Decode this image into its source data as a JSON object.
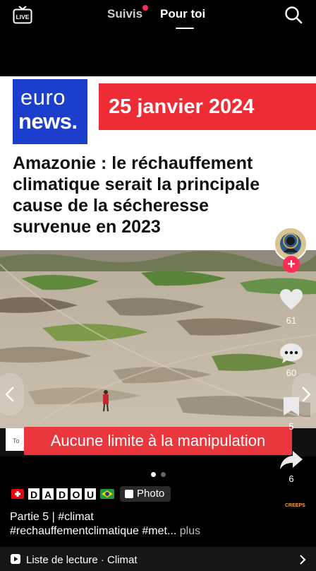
{
  "top_nav": {
    "live_label": "LIVE",
    "tab_following": "Suivis",
    "tab_for_you": "Pour toi"
  },
  "card": {
    "logo_line1": "euro",
    "logo_line2": "news.",
    "date": "25 janvier 2024",
    "headline_lines": [
      "Amazonie : le réchauffement",
      "climatique serait la principale",
      "cause de la sécheresse",
      "survenue en 2023"
    ]
  },
  "overlay_caption": "Aucune limite à la manipulation",
  "left_edge_text": "To",
  "rail": {
    "likes": "61",
    "comments": "60",
    "saves": "5",
    "shares": "6"
  },
  "carousel": {
    "current": 1,
    "total": 2
  },
  "author": {
    "letters": [
      "D",
      "A",
      "D",
      "O",
      "U"
    ],
    "photo_badge": "Photo"
  },
  "description": {
    "line1": "Partie 5 | #climat",
    "line2_text": "#rechauffementclimatique #met...",
    "more": "plus"
  },
  "watermark": "CREEPS",
  "playlist": {
    "label": "Liste de lecture · Climat"
  },
  "colors": {
    "accent_red": "#fe2c55",
    "euronews_blue": "#1b3fcc",
    "banner_red": "#ed2c36"
  }
}
